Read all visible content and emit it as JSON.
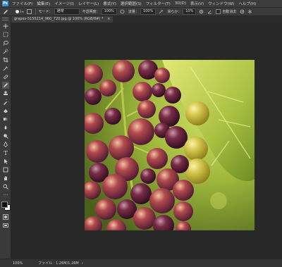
{
  "app": {
    "logo_text": "Ps"
  },
  "menubar": {
    "items": [
      "ファイル(F)",
      "編集(E)",
      "イメージ(I)",
      "レイヤー(L)",
      "書式(Y)",
      "選択範囲(S)",
      "フィルター(T)",
      "3D(D)",
      "表示(V)",
      "ウィンドウ(W)",
      "ヘルプ(H)"
    ]
  },
  "options": {
    "brush_size": "3",
    "mode_label": "モード：",
    "mode_value": "通常",
    "opacity_label": "不透明度：",
    "opacity_value": "100%",
    "flow_label": "流量：",
    "flow_value": "100%",
    "smoothing_label": "滑らか：",
    "smoothing_value": "10%",
    "auto_erase_label": "自動消去"
  },
  "document": {
    "tab_title": "grapes-5155214_960_720.jpg @ 100% (RGB/8#) *",
    "close_glyph": "×"
  },
  "status": {
    "zoom": "100%",
    "file_info": "ファイル : 1.26M/1.26M",
    "arrow": "›"
  },
  "colors": {
    "ui_bg": "#282828",
    "panel": "#3a3a3a",
    "accent": "#3a8ed3"
  },
  "icons": [
    "move",
    "marquee",
    "lasso",
    "quick-select",
    "crop",
    "eyedropper",
    "healing",
    "brush",
    "stamp",
    "history-brush",
    "eraser",
    "gradient",
    "blur",
    "dodge",
    "pen",
    "type",
    "path-select",
    "shape",
    "hand",
    "zoom",
    "more",
    "colors",
    "quick-mask",
    "screen-mode"
  ]
}
